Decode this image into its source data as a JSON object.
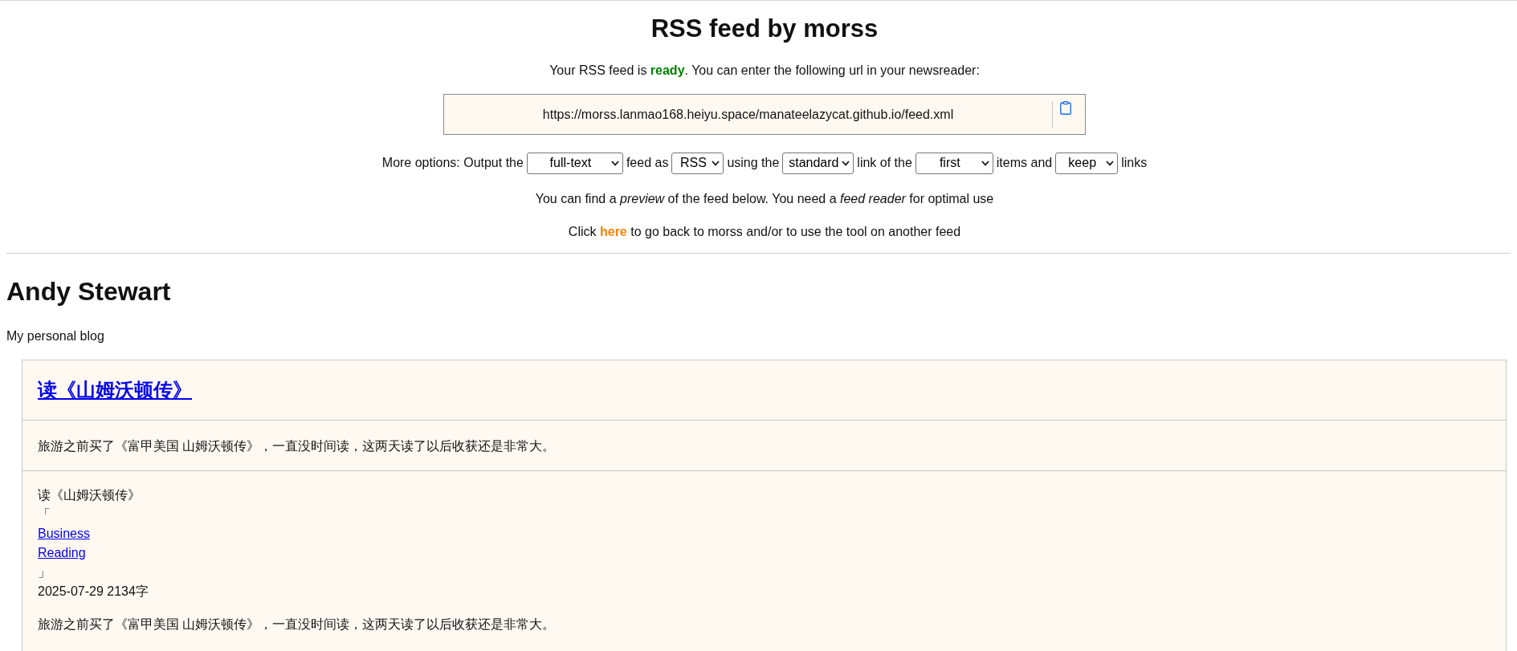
{
  "header": {
    "title": "RSS feed by morss",
    "status": "Your RSS feed is **ready**. You can enter the following url in your newsreader:",
    "feed_url": "https://morss.lanmao168.heiyu.space/manateelazycat.github.io/feed.xml"
  },
  "options": [
    {
      "kind": "text",
      "text": "More options: Output the"
    },
    {
      "kind": "select",
      "value": "full-text"
    },
    {
      "kind": "text",
      "text": "feed as"
    },
    {
      "kind": "select",
      "value": "RSS"
    },
    {
      "kind": "text",
      "text": "using the"
    },
    {
      "kind": "select",
      "value": "standard"
    },
    {
      "kind": "text",
      "text": "link of the"
    },
    {
      "kind": "select",
      "value": "first"
    },
    {
      "kind": "text",
      "text": "items and"
    },
    {
      "kind": "select",
      "value": "keep"
    },
    {
      "kind": "text",
      "text": "links"
    }
  ],
  "preview_note": "You can find a *preview* of the feed below. You need a *feed reader* for optimal use",
  "back_note": {
    "before": "Click",
    "link": "here",
    "after": "to go back to morss and/or to use the tool on another feed"
  },
  "feed": {
    "title": "Andy Stewart",
    "description": "My personal blog",
    "items": [
      {
        "title": "读《山姆沃顿传》",
        "summary": "旅游之前买了《富甲美国 山姆沃顿传》，一直没时间读，这两天读了以后收获还是非常大。",
        "content": {
          "heading": "读《山姆沃顿传》",
          "open_bracket": "「",
          "tags": [
            "Business",
            "Reading"
          ],
          "close_bracket": "」",
          "meta": "2025-07-29 2134字",
          "paragraphs": [
            "旅游之前买了《富甲美国 山姆沃顿传》，一直没时间读，这两天读了以后收获还是非常大。"
          ]
        }
      }
    ]
  }
}
